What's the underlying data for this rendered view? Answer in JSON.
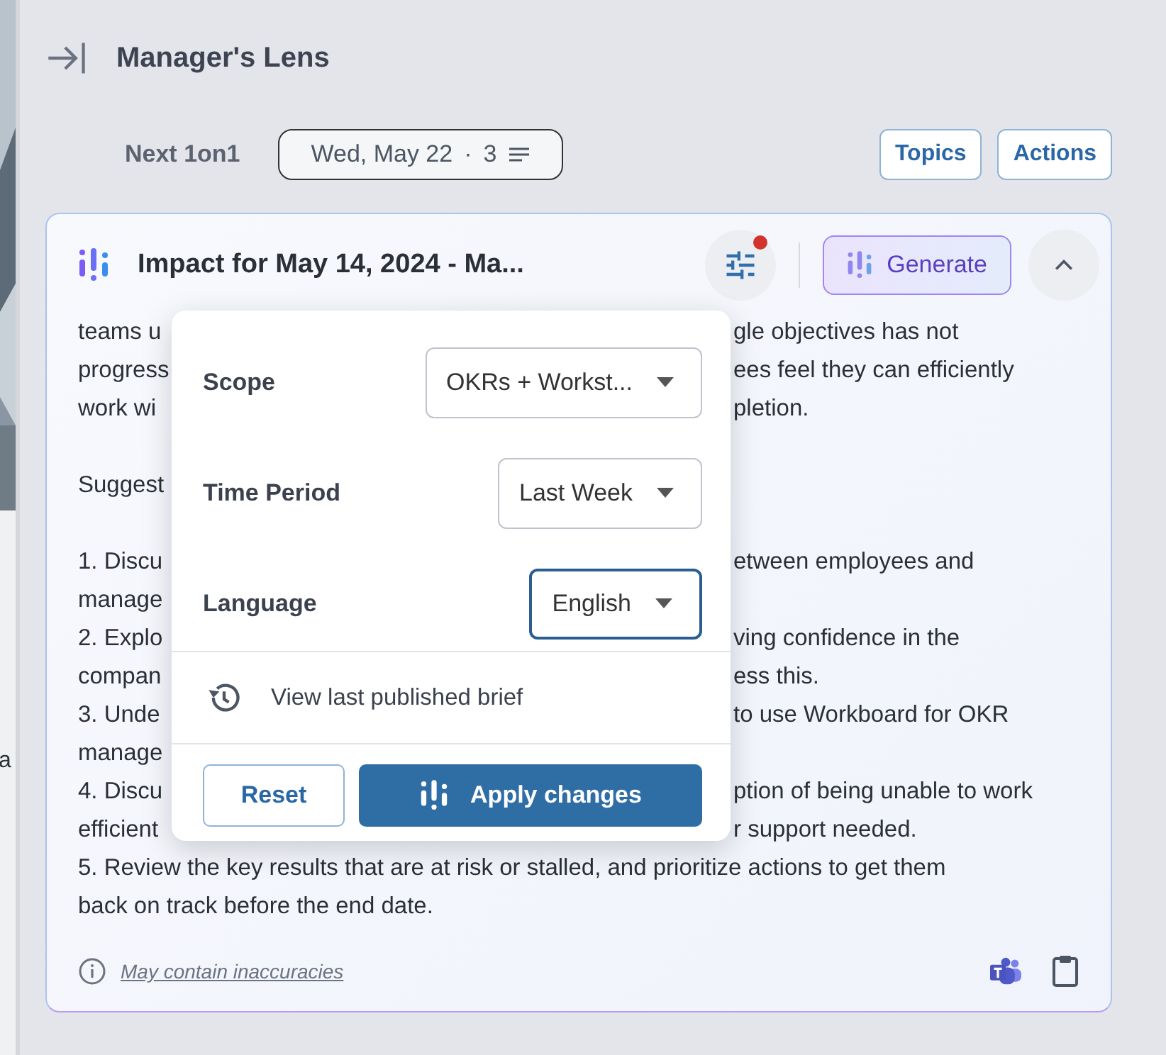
{
  "side_strip": {
    "kind": "picture",
    "fragment": "a"
  },
  "header": {
    "title": "Manager's Lens"
  },
  "next_meeting": {
    "label": "Next 1on1",
    "date": "Wed, May 22",
    "separator": "·",
    "count": "3"
  },
  "header_buttons": [
    "Topics",
    "Actions"
  ],
  "card": {
    "title": "Impact for May 14, 2024 - Ma...",
    "filters_changed": true,
    "generate_label": "Generate",
    "lines": [
      {
        "kind": "split",
        "left": "teams u",
        "right": "gle objectives has not"
      },
      {
        "kind": "split",
        "left": "progress",
        "right": "ees feel they can efficiently"
      },
      {
        "kind": "split",
        "left": "work wi",
        "right": "pletion."
      },
      {
        "kind": "blank"
      },
      {
        "kind": "split",
        "left": "Suggest"
      },
      {
        "kind": "blank"
      },
      {
        "kind": "split",
        "left": "1. Discu",
        "right": "etween employees and"
      },
      {
        "kind": "split",
        "left": "manage"
      },
      {
        "kind": "split",
        "left": "2. Explo",
        "right": "ving confidence in the"
      },
      {
        "kind": "split",
        "left": "compan",
        "right": "ess this."
      },
      {
        "kind": "split",
        "left": "3. Unde",
        "right": "to use Workboard for OKR"
      },
      {
        "kind": "split",
        "left": "manage"
      },
      {
        "kind": "split",
        "left": "4. Discu",
        "right": "ption of being unable to work"
      },
      {
        "kind": "split",
        "left": "efficient",
        "right": "r support needed."
      },
      {
        "kind": "full",
        "text": "5. Review the key results that are at risk or stalled, and prioritize actions to get them"
      },
      {
        "kind": "full",
        "text": "back on track before the end date."
      }
    ],
    "disclaimer": "May contain inaccuracies"
  },
  "popover": {
    "fields": [
      {
        "label": "Scope",
        "value": "OKRs + Workst...",
        "focused": false
      },
      {
        "label": "Time Period",
        "value": "Last Week",
        "focused": false
      },
      {
        "label": "Language",
        "value": "English",
        "focused": true
      }
    ],
    "history_link": "View last published brief",
    "reset": "Reset",
    "apply": "Apply changes"
  }
}
